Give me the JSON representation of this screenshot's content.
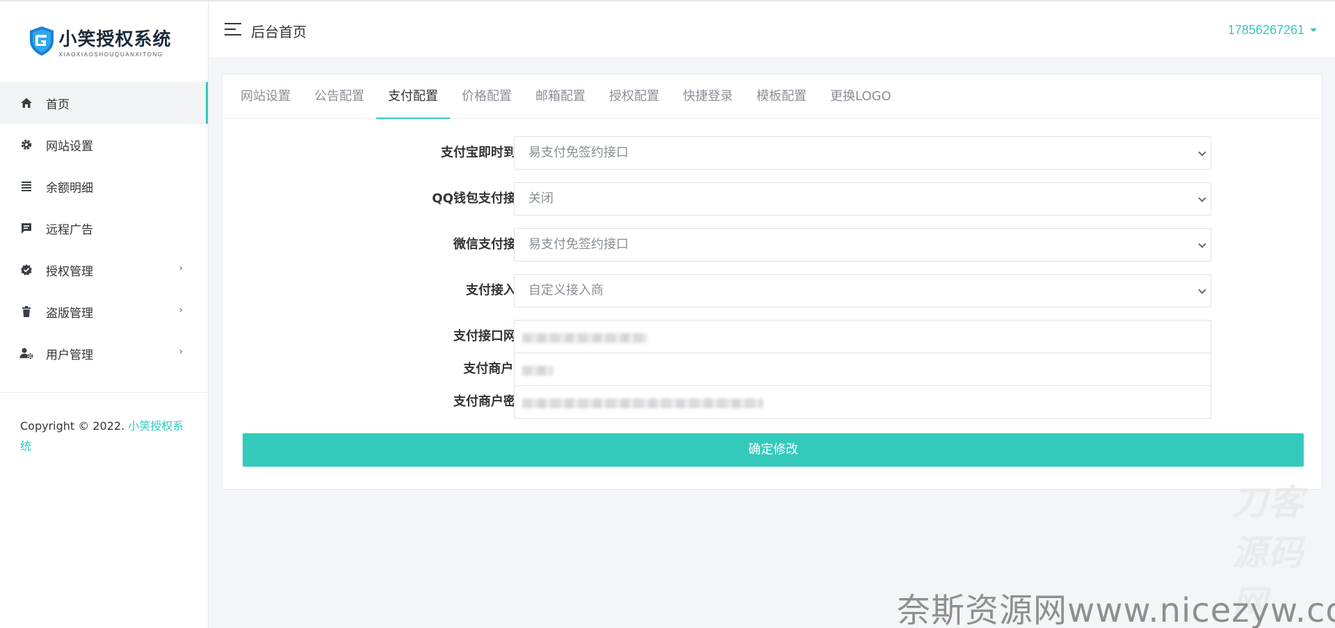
{
  "brand": {
    "title": "小笑授权系统",
    "subtitle": "XIAOXIAOSHOUQUANXITONG",
    "color": "#33cabb"
  },
  "sidebar": {
    "items": [
      {
        "label": "首页",
        "icon": "home-icon",
        "active": true
      },
      {
        "label": "网站设置",
        "icon": "gear-icon"
      },
      {
        "label": "余额明细",
        "icon": "list-icon"
      },
      {
        "label": "远程广告",
        "icon": "message-icon"
      },
      {
        "label": "授权管理",
        "icon": "badge-check-icon",
        "has_children": true
      },
      {
        "label": "盗版管理",
        "icon": "trash-icon",
        "has_children": true
      },
      {
        "label": "用户管理",
        "icon": "user-gear-icon",
        "has_children": true
      }
    ],
    "copyright_prefix": "Copyright © 2022. ",
    "copyright_link": "小笑授权系统"
  },
  "header": {
    "title": "后台首页",
    "user": "17856267261"
  },
  "tabs": [
    "网站设置",
    "公告配置",
    "支付配置",
    "价格配置",
    "邮箱配置",
    "授权配置",
    "快捷登录",
    "模板配置",
    "更换LOGO"
  ],
  "active_tab": "支付配置",
  "form": {
    "alipay": {
      "label": "支付宝即时到账",
      "value": "易支付免签约接口"
    },
    "qqpay": {
      "label": "QQ钱包支付接口",
      "value": "关闭"
    },
    "wxpay": {
      "label": "微信支付接口",
      "value": "易支付免签约接口"
    },
    "provider": {
      "label": "支付接入商",
      "value": "自定义接入商"
    },
    "api_url": {
      "label": "支付接口网址"
    },
    "merchant_id": {
      "label": "支付商户ID"
    },
    "merchant_key": {
      "label": "支付商户密钥"
    },
    "submit": "确定修改"
  },
  "watermarks": {
    "center": "刀客源码网",
    "corner": "奈斯资源网www.nicezyw.com"
  }
}
